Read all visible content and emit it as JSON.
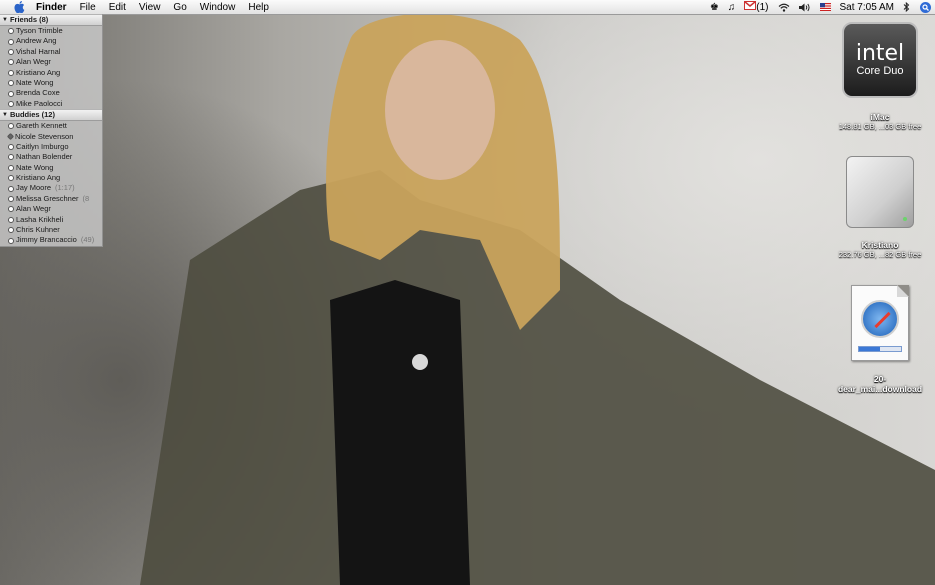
{
  "menubar": {
    "app_name": "Finder",
    "menus": [
      "File",
      "Edit",
      "View",
      "Go",
      "Window",
      "Help"
    ],
    "mail_count": "(1)",
    "clock": "Sat 7:05 AM",
    "icons": [
      "apple-icon",
      "chess-icon",
      "music-note-icon",
      "gmail-icon",
      "wifi-icon",
      "volume-icon",
      "flag-icon",
      "bluetooth-icon",
      "spotlight-icon"
    ]
  },
  "buddylist": {
    "groups": [
      {
        "title": "Friends (8)",
        "buddies": [
          {
            "name": "Tyson Trimble",
            "idle": ""
          },
          {
            "name": "Andrew Ang",
            "idle": ""
          },
          {
            "name": "Vishal Harnal",
            "idle": ""
          },
          {
            "name": "Alan Wegr",
            "idle": ""
          },
          {
            "name": "Kristiano Ang",
            "idle": ""
          },
          {
            "name": "Nate Wong",
            "idle": ""
          },
          {
            "name": "Brenda Coxe",
            "idle": ""
          },
          {
            "name": "Mike Paolocci",
            "idle": ""
          }
        ]
      },
      {
        "title": "Buddies (12)",
        "buddies": [
          {
            "name": "Gareth Kennett",
            "idle": ""
          },
          {
            "name": "Nicole Stevenson",
            "idle": ""
          },
          {
            "name": "Caitlyn Imburgo",
            "idle": ""
          },
          {
            "name": "Nathan Bolender",
            "idle": ""
          },
          {
            "name": "Nate Wong",
            "idle": ""
          },
          {
            "name": "Kristiano Ang",
            "idle": ""
          },
          {
            "name": "Jay Moore",
            "idle": "(1:17)"
          },
          {
            "name": "Melissa Greschner",
            "idle": "(8"
          },
          {
            "name": "Alan Wegr",
            "idle": ""
          },
          {
            "name": "Lasha Krikheli",
            "idle": ""
          },
          {
            "name": "Chris Kuhner",
            "idle": ""
          },
          {
            "name": "Jimmy Brancaccio",
            "idle": "(49)"
          }
        ]
      }
    ]
  },
  "desktop": {
    "imac": {
      "chip_brand": "intel",
      "chip_model": "Core Duo",
      "name": "iMac",
      "info": "148.81 GB, ...03 GB free"
    },
    "drive": {
      "name": "Kristiano",
      "info": "232.76 GB, ...82 GB free"
    },
    "download": {
      "name_line1": "20-",
      "name_line2": "dear_mai...download",
      "progress": 0.5
    }
  },
  "colors": {
    "menubar": "#eeeeee",
    "spotlight": "#2f6bd6",
    "buddylist": "#cdcdcd"
  }
}
